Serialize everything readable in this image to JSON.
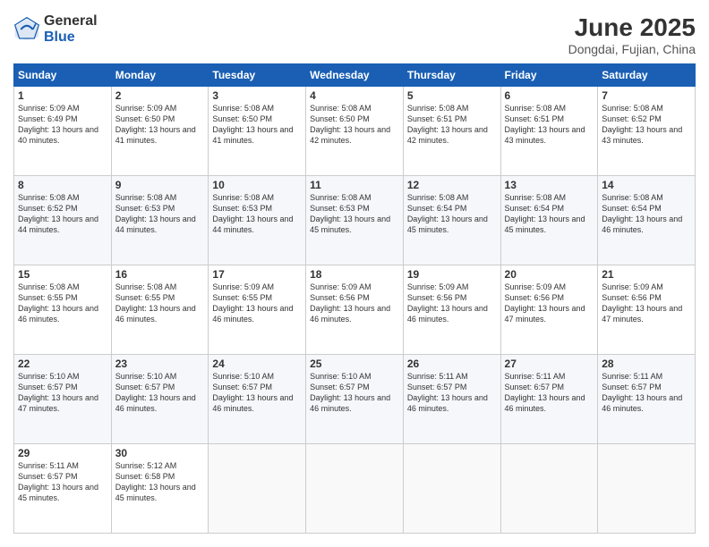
{
  "logo": {
    "general": "General",
    "blue": "Blue"
  },
  "title": {
    "month_year": "June 2025",
    "location": "Dongdai, Fujian, China"
  },
  "weekdays": [
    "Sunday",
    "Monday",
    "Tuesday",
    "Wednesday",
    "Thursday",
    "Friday",
    "Saturday"
  ],
  "weeks": [
    [
      {
        "day": "1",
        "sunrise": "5:09 AM",
        "sunset": "6:49 PM",
        "daylight": "13 hours and 40 minutes."
      },
      {
        "day": "2",
        "sunrise": "5:09 AM",
        "sunset": "6:50 PM",
        "daylight": "13 hours and 41 minutes."
      },
      {
        "day": "3",
        "sunrise": "5:08 AM",
        "sunset": "6:50 PM",
        "daylight": "13 hours and 41 minutes."
      },
      {
        "day": "4",
        "sunrise": "5:08 AM",
        "sunset": "6:50 PM",
        "daylight": "13 hours and 42 minutes."
      },
      {
        "day": "5",
        "sunrise": "5:08 AM",
        "sunset": "6:51 PM",
        "daylight": "13 hours and 42 minutes."
      },
      {
        "day": "6",
        "sunrise": "5:08 AM",
        "sunset": "6:51 PM",
        "daylight": "13 hours and 43 minutes."
      },
      {
        "day": "7",
        "sunrise": "5:08 AM",
        "sunset": "6:52 PM",
        "daylight": "13 hours and 43 minutes."
      }
    ],
    [
      {
        "day": "8",
        "sunrise": "5:08 AM",
        "sunset": "6:52 PM",
        "daylight": "13 hours and 44 minutes."
      },
      {
        "day": "9",
        "sunrise": "5:08 AM",
        "sunset": "6:53 PM",
        "daylight": "13 hours and 44 minutes."
      },
      {
        "day": "10",
        "sunrise": "5:08 AM",
        "sunset": "6:53 PM",
        "daylight": "13 hours and 44 minutes."
      },
      {
        "day": "11",
        "sunrise": "5:08 AM",
        "sunset": "6:53 PM",
        "daylight": "13 hours and 45 minutes."
      },
      {
        "day": "12",
        "sunrise": "5:08 AM",
        "sunset": "6:54 PM",
        "daylight": "13 hours and 45 minutes."
      },
      {
        "day": "13",
        "sunrise": "5:08 AM",
        "sunset": "6:54 PM",
        "daylight": "13 hours and 45 minutes."
      },
      {
        "day": "14",
        "sunrise": "5:08 AM",
        "sunset": "6:54 PM",
        "daylight": "13 hours and 46 minutes."
      }
    ],
    [
      {
        "day": "15",
        "sunrise": "5:08 AM",
        "sunset": "6:55 PM",
        "daylight": "13 hours and 46 minutes."
      },
      {
        "day": "16",
        "sunrise": "5:08 AM",
        "sunset": "6:55 PM",
        "daylight": "13 hours and 46 minutes."
      },
      {
        "day": "17",
        "sunrise": "5:09 AM",
        "sunset": "6:55 PM",
        "daylight": "13 hours and 46 minutes."
      },
      {
        "day": "18",
        "sunrise": "5:09 AM",
        "sunset": "6:56 PM",
        "daylight": "13 hours and 46 minutes."
      },
      {
        "day": "19",
        "sunrise": "5:09 AM",
        "sunset": "6:56 PM",
        "daylight": "13 hours and 46 minutes."
      },
      {
        "day": "20",
        "sunrise": "5:09 AM",
        "sunset": "6:56 PM",
        "daylight": "13 hours and 47 minutes."
      },
      {
        "day": "21",
        "sunrise": "5:09 AM",
        "sunset": "6:56 PM",
        "daylight": "13 hours and 47 minutes."
      }
    ],
    [
      {
        "day": "22",
        "sunrise": "5:10 AM",
        "sunset": "6:57 PM",
        "daylight": "13 hours and 47 minutes."
      },
      {
        "day": "23",
        "sunrise": "5:10 AM",
        "sunset": "6:57 PM",
        "daylight": "13 hours and 46 minutes."
      },
      {
        "day": "24",
        "sunrise": "5:10 AM",
        "sunset": "6:57 PM",
        "daylight": "13 hours and 46 minutes."
      },
      {
        "day": "25",
        "sunrise": "5:10 AM",
        "sunset": "6:57 PM",
        "daylight": "13 hours and 46 minutes."
      },
      {
        "day": "26",
        "sunrise": "5:11 AM",
        "sunset": "6:57 PM",
        "daylight": "13 hours and 46 minutes."
      },
      {
        "day": "27",
        "sunrise": "5:11 AM",
        "sunset": "6:57 PM",
        "daylight": "13 hours and 46 minutes."
      },
      {
        "day": "28",
        "sunrise": "5:11 AM",
        "sunset": "6:57 PM",
        "daylight": "13 hours and 46 minutes."
      }
    ],
    [
      {
        "day": "29",
        "sunrise": "5:11 AM",
        "sunset": "6:57 PM",
        "daylight": "13 hours and 45 minutes."
      },
      {
        "day": "30",
        "sunrise": "5:12 AM",
        "sunset": "6:58 PM",
        "daylight": "13 hours and 45 minutes."
      },
      null,
      null,
      null,
      null,
      null
    ]
  ],
  "labels": {
    "sunrise": "Sunrise:",
    "sunset": "Sunset:",
    "daylight": "Daylight:"
  }
}
